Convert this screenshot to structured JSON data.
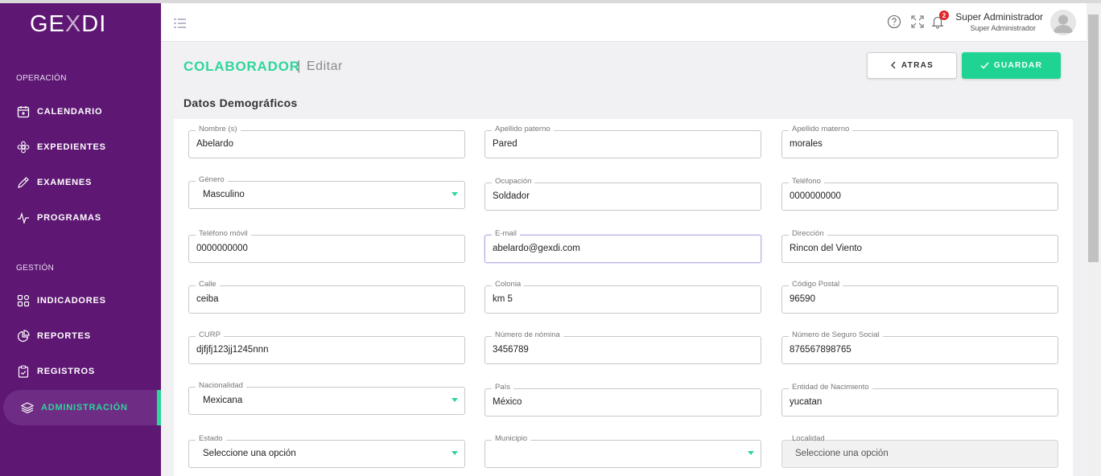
{
  "app": {
    "logo_pre": "GE",
    "logo_x": "X",
    "logo_post": "DI"
  },
  "sidebar": {
    "sections": [
      {
        "title": "OPERACIÓN"
      },
      {
        "title": "GESTIÓN"
      }
    ],
    "items": [
      {
        "label": "CALENDARIO",
        "icon": "calendar-icon"
      },
      {
        "label": "EXPEDIENTES",
        "icon": "flower-icon"
      },
      {
        "label": "EXAMENES",
        "icon": "pencil-icon"
      },
      {
        "label": "PROGRAMAS",
        "icon": "pulse-icon"
      },
      {
        "label": "INDICADORES",
        "icon": "grid-icon"
      },
      {
        "label": "REPORTES",
        "icon": "pie-chart-icon"
      },
      {
        "label": "REGISTROS",
        "icon": "clipboard-icon"
      },
      {
        "label": "ADMINISTRACIÓN",
        "icon": "layers-icon",
        "active": true
      }
    ]
  },
  "header": {
    "notifications_count": "2",
    "user_name": "Super Administrador",
    "user_role": "Super Administrador"
  },
  "page": {
    "title": "COLABORADOR",
    "separator": "|",
    "subtitle": "Editar",
    "back_label": "ATRAS",
    "save_label": "GUARDAR",
    "section_title": "Datos Demográficos"
  },
  "form": {
    "nombre": {
      "label": "Nombre (s)",
      "value": "Abelardo"
    },
    "apellido_paterno": {
      "label": "Apellido paterno",
      "value": "Pared"
    },
    "apellido_materno": {
      "label": "Apellido materno",
      "value": "morales"
    },
    "genero": {
      "label": "Género",
      "value": "Masculino"
    },
    "ocupacion": {
      "label": "Ocupación",
      "value": "Soldador"
    },
    "telefono": {
      "label": "Teléfono",
      "value": "0000000000"
    },
    "telefono_movil": {
      "label": "Teléfono móvil",
      "value": "0000000000"
    },
    "email": {
      "label": "E-mail",
      "value": "abelardo@gexdi.com"
    },
    "direccion": {
      "label": "Dirección",
      "value": "Rincon del Viento"
    },
    "calle": {
      "label": "Calle",
      "value": "ceiba"
    },
    "colonia": {
      "label": "Colonia",
      "value": "km 5"
    },
    "codigo_postal": {
      "label": "Código Postal",
      "value": "96590"
    },
    "curp": {
      "label": "CURP",
      "value": "djfjfj123jj1245nnn"
    },
    "numero_nomina": {
      "label": "Número de nómina",
      "value": "3456789"
    },
    "nss": {
      "label": "Número de Seguro Social",
      "value": "876567898765"
    },
    "nacionalidad": {
      "label": "Nacionalidad",
      "value": "Mexicana"
    },
    "pais": {
      "label": "País",
      "value": "México"
    },
    "entidad_nacimiento": {
      "label": "Entidad de Nacimiento",
      "value": "yucatan"
    },
    "estado": {
      "label": "Estado",
      "value": "Seleccione una opción"
    },
    "municipio": {
      "label": "Municipio",
      "value": ""
    },
    "localidad": {
      "label": "Localidad",
      "value": "Seleccione una opción"
    }
  },
  "colors": {
    "primary": "#5e1773",
    "accent": "#2ed69a",
    "save": "#1fd493"
  }
}
